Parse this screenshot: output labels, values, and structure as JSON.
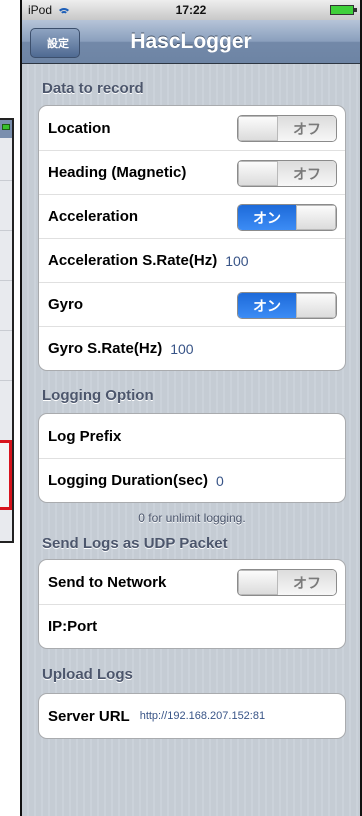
{
  "status": {
    "carrier": "iPod",
    "time": "17:22"
  },
  "nav": {
    "back": "設定",
    "title": "HascLogger"
  },
  "sections": {
    "data_to_record": "Data to record",
    "logging_option": "Logging Option",
    "logging_footer": "0 for unlimit logging.",
    "send_logs": "Send Logs as UDP Packet",
    "upload_logs": "Upload Logs"
  },
  "rows": {
    "location": {
      "label": "Location",
      "state": "オフ"
    },
    "heading": {
      "label": "Heading (Magnetic)",
      "state": "オフ"
    },
    "acceleration": {
      "label": "Acceleration",
      "state": "オン"
    },
    "accel_rate": {
      "label": "Acceleration S.Rate(Hz)",
      "value": "100"
    },
    "gyro": {
      "label": "Gyro",
      "state": "オン"
    },
    "gyro_rate": {
      "label": "Gyro S.Rate(Hz)",
      "value": "100"
    },
    "log_prefix": {
      "label": "Log Prefix"
    },
    "logging_duration": {
      "label": "Logging Duration(sec)",
      "value": "0"
    },
    "send_network": {
      "label": "Send to Network",
      "state": "オフ"
    },
    "ip_port": {
      "label": "IP:Port"
    },
    "server_url": {
      "label": "Server URL",
      "value": "http://192.168.207.152:81"
    }
  },
  "colors": {
    "background_stripes": "#c5ccd4",
    "navbar": "#6d84a4",
    "switch_on": "#2f7cee",
    "value_text": "#385487",
    "highlight_red": "#d8141c"
  }
}
